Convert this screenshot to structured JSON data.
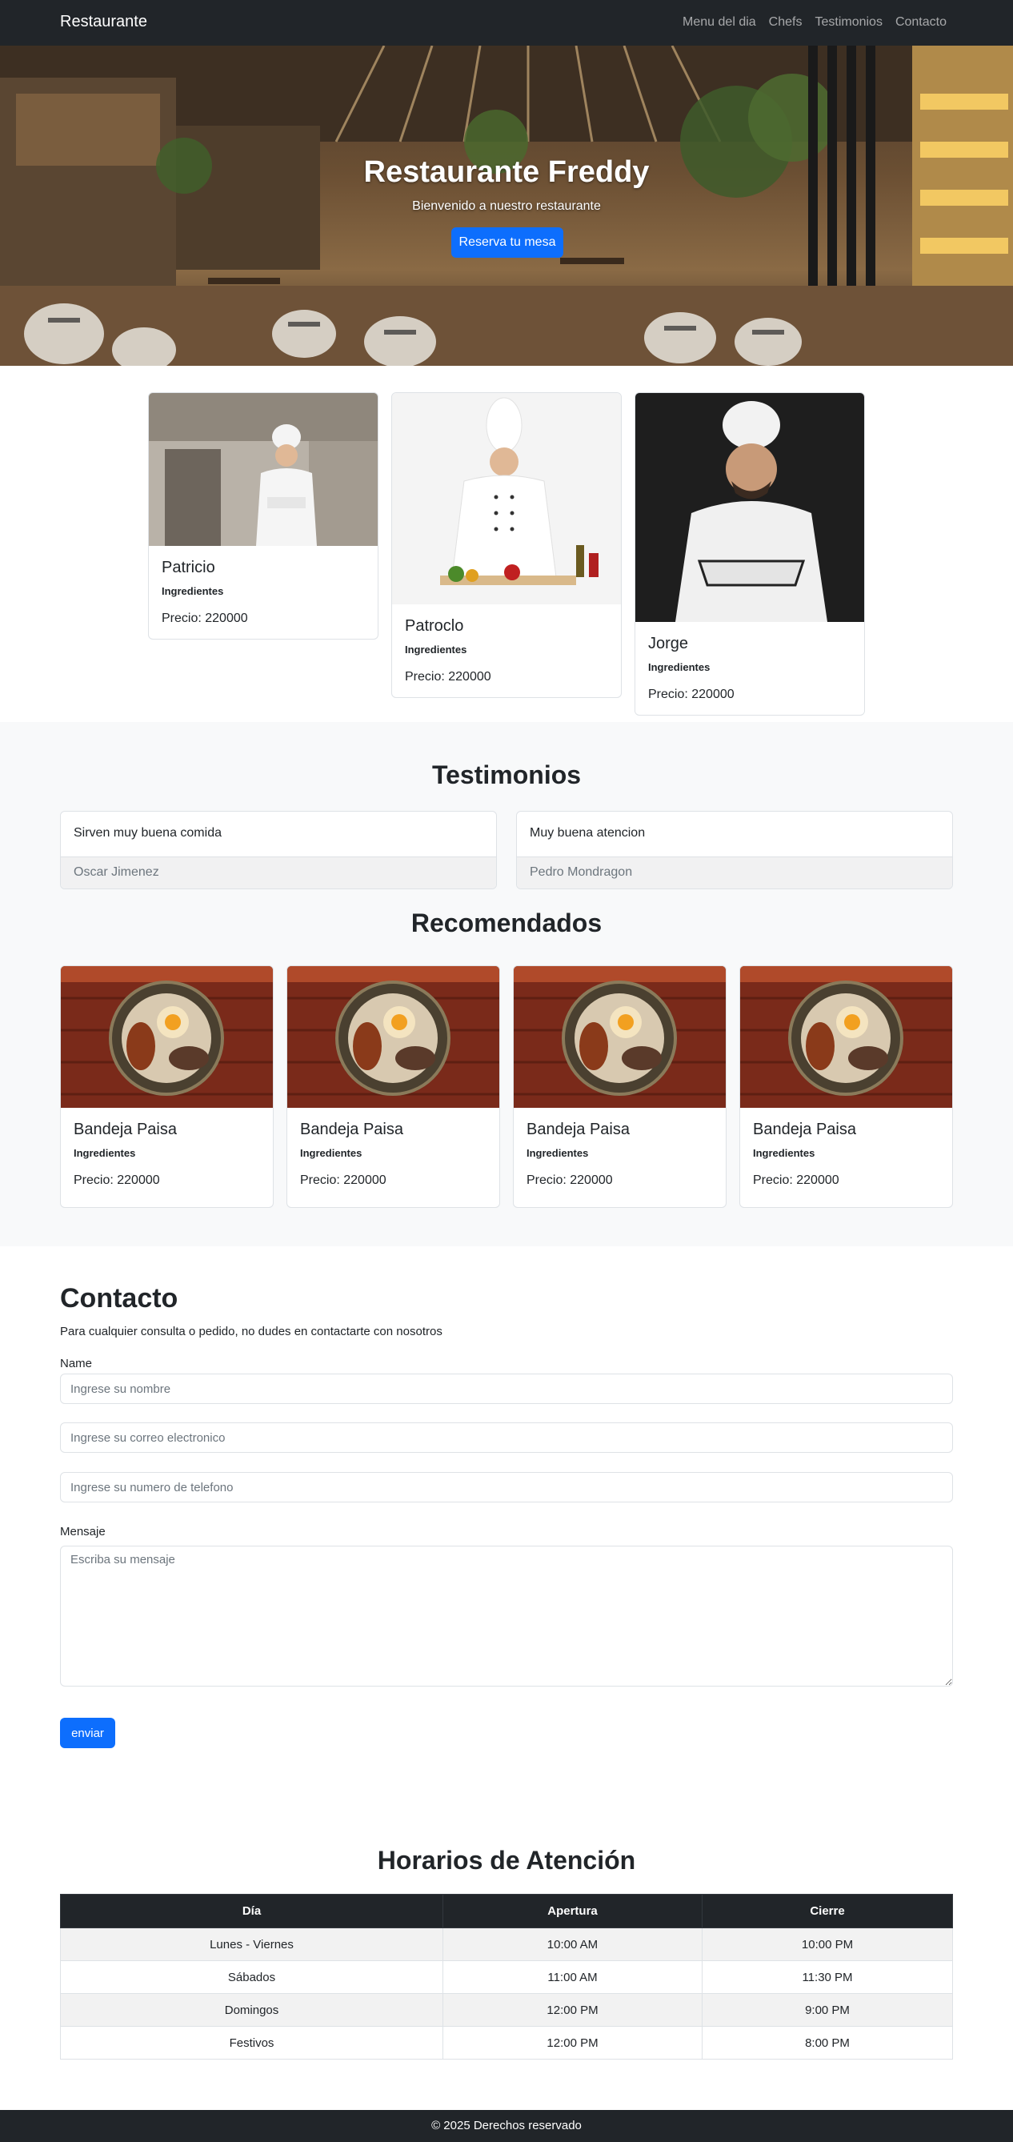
{
  "navbar": {
    "brand": "Restaurante",
    "links": [
      "Menu del dia",
      "Chefs",
      "Testimonios",
      "Contacto"
    ]
  },
  "hero": {
    "title": "Restaurante Freddy",
    "subtitle": "Bienvenido a nuestro restaurante",
    "button": "Reserva tu mesa"
  },
  "chefs": [
    {
      "name": "Patricio",
      "ingredients": "Ingredientes",
      "price": "Precio: 220000"
    },
    {
      "name": "Patroclo",
      "ingredients": "Ingredientes",
      "price": "Precio: 220000"
    },
    {
      "name": "Jorge",
      "ingredients": "Ingredientes",
      "price": "Precio: 220000"
    }
  ],
  "testimonios": {
    "title": "Testimonios",
    "items": [
      {
        "text": "Sirven muy buena comida",
        "author": "Oscar Jimenez"
      },
      {
        "text": "Muy buena atencion",
        "author": "Pedro Mondragon"
      }
    ]
  },
  "recomendados": {
    "title": "Recomendados",
    "items": [
      {
        "name": "Bandeja Paisa",
        "ingredients": "Ingredientes",
        "price": "Precio: 220000"
      },
      {
        "name": "Bandeja Paisa",
        "ingredients": "Ingredientes",
        "price": "Precio: 220000"
      },
      {
        "name": "Bandeja Paisa",
        "ingredients": "Ingredientes",
        "price": "Precio: 220000"
      },
      {
        "name": "Bandeja Paisa",
        "ingredients": "Ingredientes",
        "price": "Precio: 220000"
      }
    ]
  },
  "contacto": {
    "title": "Contacto",
    "description": "Para cualquier consulta o pedido, no dudes en contactarte con nosotros",
    "name_label": "Name",
    "name_placeholder": "Ingrese su nombre",
    "email_placeholder": "Ingrese su correo electronico",
    "phone_placeholder": "Ingrese su numero de telefono",
    "message_label": "Mensaje",
    "message_placeholder": "Escriba su mensaje",
    "send_button": "enviar"
  },
  "horarios": {
    "title": "Horarios de Atención",
    "headers": [
      "Día",
      "Apertura",
      "Cierre"
    ],
    "rows": [
      [
        "Lunes - Viernes",
        "10:00 AM",
        "10:00 PM"
      ],
      [
        "Sábados",
        "11:00 AM",
        "11:30 PM"
      ],
      [
        "Domingos",
        "12:00 PM",
        "9:00 PM"
      ],
      [
        "Festivos",
        "12:00 PM",
        "8:00 PM"
      ]
    ]
  },
  "footer": {
    "text": "© 2025 Derechos reservado"
  },
  "colors": {
    "navbar": "#212529",
    "primary": "#0d6efd",
    "section_gray": "#f8f9fa"
  }
}
